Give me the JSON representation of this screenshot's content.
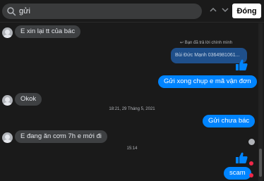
{
  "search": {
    "query": "gửi"
  },
  "toolbar": {
    "close_label": "Đóng"
  },
  "messages": {
    "m1": "E xin lại tt của bác",
    "reply_note": "Bạn đã trả lời chính mình",
    "reply_quote": "Bùi Đức Mạnh 0364981061...",
    "m2": "Gửi xong chụp e mã vận đơn",
    "m3": "Okok",
    "ts1": "18:21, 29 Tháng 5, 2021",
    "m4": "Gửi chưa bác",
    "m5": "E đang ăn cơm 7h e mới đi",
    "ts2": "15:14",
    "m6": "scam"
  },
  "colors": {
    "outgoing": "#0084ff",
    "incoming": "#3e4042",
    "error": "#f02849"
  }
}
